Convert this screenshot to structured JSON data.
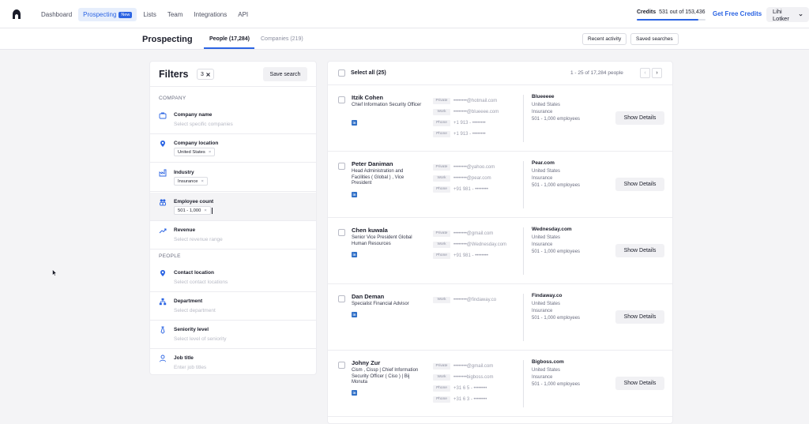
{
  "nav": {
    "links": [
      {
        "label": "Dashboard"
      },
      {
        "label": "Prospecting",
        "badge": "New",
        "active": true
      },
      {
        "label": "Lists"
      },
      {
        "label": "Team"
      },
      {
        "label": "Integrations"
      },
      {
        "label": "API"
      }
    ],
    "credits_label": "Credits",
    "credits_value": "531 out of 153,436",
    "credits_used_fraction": 0.9,
    "free_credits": "Get Free Credits",
    "user_name": "Lihi Lotker"
  },
  "subheader": {
    "title": "Prospecting",
    "tab_people": "People (17,284)",
    "tab_companies": "Companies (219)",
    "recent_activity": "Recent activity",
    "saved_searches": "Saved searches"
  },
  "filters": {
    "title": "Filters",
    "count": "3",
    "save_search": "Save search",
    "company_section": "COMPANY",
    "people_section": "PEOPLE",
    "company_name": {
      "label": "Company name",
      "placeholder": "Select specific companies"
    },
    "company_location": {
      "label": "Company location",
      "chip": "United States"
    },
    "industry": {
      "label": "Industry",
      "chip": "Insurance"
    },
    "employee_count": {
      "label": "Employee count",
      "chip": "501 - 1,000"
    },
    "revenue": {
      "label": "Revenue",
      "placeholder": "Select revenue range"
    },
    "contact_location": {
      "label": "Contact location",
      "placeholder": "Select contact locations"
    },
    "department": {
      "label": "Department",
      "placeholder": "Select department"
    },
    "seniority": {
      "label": "Seniority level",
      "placeholder": "Select level of seniority"
    },
    "job_title": {
      "label": "Job title",
      "placeholder": "Enter job titles"
    }
  },
  "results": {
    "select_all": "Select all (25)",
    "range": "1 - 25 of 17,284 people",
    "prev": "‹",
    "next": "›",
    "show_details": "Show Details",
    "people": [
      {
        "name": "Itzik Cohen",
        "title": "Chief Information Security Officer",
        "contacts": [
          {
            "tag": "Private",
            "value": "••••••••@hotmail.com"
          },
          {
            "tag": "Work",
            "value": "••••••••@blueeee.com"
          },
          {
            "tag": "Phone",
            "value": "+1 913 - ••••••••"
          },
          {
            "tag": "Phone",
            "value": "+1 913 - ••••••••"
          }
        ],
        "company": "Blueeeee",
        "country": "United States",
        "industry": "Insurance",
        "size": "501 - 1,000 employees"
      },
      {
        "name": "Peter Daniman",
        "title": "Head Administration and Facilities ( Global ) , Vice President",
        "contacts": [
          {
            "tag": "Private",
            "value": "••••••••@yahoo.com"
          },
          {
            "tag": "Work",
            "value": "••••••••@pear.com"
          },
          {
            "tag": "Phone",
            "value": "+91 981 - ••••••••"
          }
        ],
        "company": "Pear.com",
        "country": "United States",
        "industry": "Insurance",
        "size": "501 - 1,000 employees"
      },
      {
        "name": "Chen kuwala",
        "title": "Senior Vice President Global Human Resources",
        "contacts": [
          {
            "tag": "Private",
            "value": "••••••••@gmail.com"
          },
          {
            "tag": "Work",
            "value": "••••••••@Wednesday.com"
          },
          {
            "tag": "Phone",
            "value": "+91 981 - ••••••••"
          }
        ],
        "company": "Wednesday.com",
        "country": "United States",
        "industry": "Insurance",
        "size": "501 - 1,000 employees"
      },
      {
        "name": "Dan Deman",
        "title": "Specialist Financial Advisor",
        "contacts": [
          {
            "tag": "Work",
            "value": "••••••••@findaway.co"
          }
        ],
        "company": "Findaway.co",
        "country": "United States",
        "industry": "Insurance",
        "size": "501 - 1,000 employees"
      },
      {
        "name": "Johny Zur",
        "title": "Cism , Cissp | Chief Information Security Officer ( Ciso ) | Bij Monuta",
        "contacts": [
          {
            "tag": "Private",
            "value": "••••••••@gmail.com"
          },
          {
            "tag": "Work",
            "value": "••••••••bigboss.com"
          },
          {
            "tag": "Phone",
            "value": "+31 6 5 - ••••••••"
          },
          {
            "tag": "Phone",
            "value": "+31 6 3 - ••••••••"
          }
        ],
        "company": "Bigboss.com",
        "country": "United States",
        "industry": "Insurance",
        "size": "501 - 1,000 employees"
      }
    ]
  }
}
